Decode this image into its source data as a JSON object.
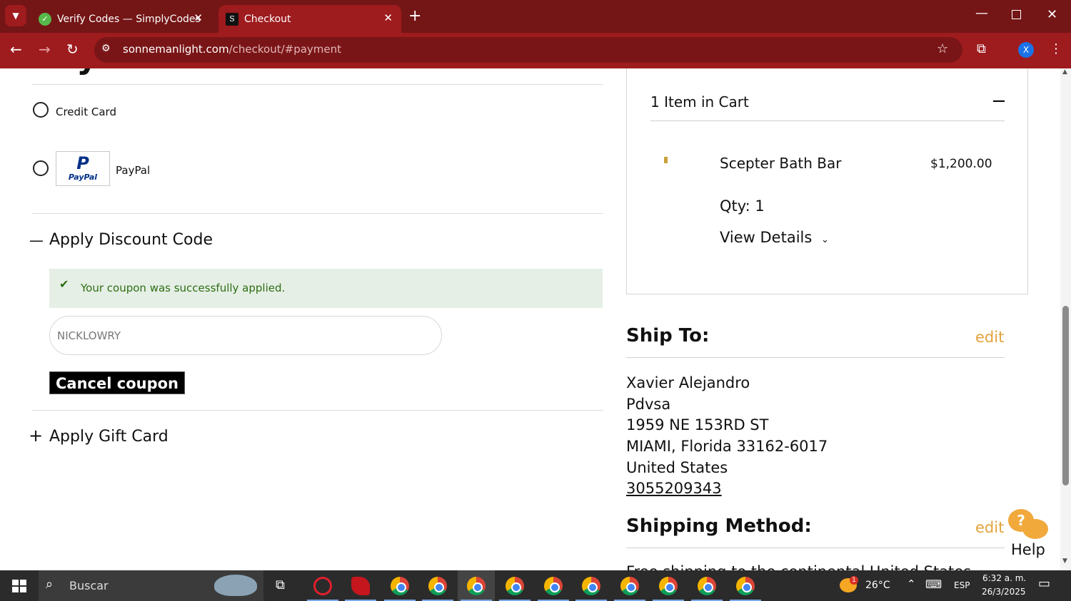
{
  "browser": {
    "tabs": [
      {
        "title": "Verify Codes — SimplyCodes",
        "active": false
      },
      {
        "title": "Checkout",
        "active": true
      }
    ],
    "url_host": "sonnemanlight.com",
    "url_path": "/checkout/#payment",
    "profile_initial": "X",
    "accent_color": "#9e1b1e"
  },
  "payment": {
    "heading_partial": "Payment Method",
    "options": [
      {
        "label": "Credit Card",
        "selected": false
      },
      {
        "label": "PayPal",
        "selected": false
      }
    ],
    "paypal_logo_top": "P",
    "paypal_logo_text": "PayPal"
  },
  "discount": {
    "title": "Apply Discount Code",
    "toggle": "—",
    "success_message": "Your coupon was successfully applied.",
    "code_value": "NICKLOWRY",
    "cancel_label": "Cancel coupon"
  },
  "gift_card": {
    "title": "Apply Gift Card",
    "toggle": "+"
  },
  "cart": {
    "summary": "1 Item in Cart",
    "collapse": "—",
    "item_name": "Scepter Bath Bar",
    "item_price": "$1,200.00",
    "qty": "Qty: 1",
    "view_details": "View Details"
  },
  "ship_to": {
    "title": "Ship To:",
    "edit": "edit",
    "lines": [
      "Xavier Alejandro",
      "Pdvsa",
      "1959 NE 153RD ST",
      "MIAMI, Florida 33162-6017",
      "United States"
    ],
    "phone": "3055209343"
  },
  "shipping_method": {
    "title": "Shipping Method:",
    "edit": "edit",
    "partial_text": "Free shipping to the continental United States"
  },
  "help": {
    "label": "Help",
    "glyph": "?"
  },
  "taskbar": {
    "search": "Buscar",
    "weather": "26°C",
    "language": "ESP",
    "time": "6:32 a. m.",
    "date": "26/3/2025",
    "weather_badge": "1"
  },
  "colors": {
    "edit_link": "#e3a33b",
    "success_bg": "#e5efe5",
    "success_text": "#2d6d13"
  }
}
